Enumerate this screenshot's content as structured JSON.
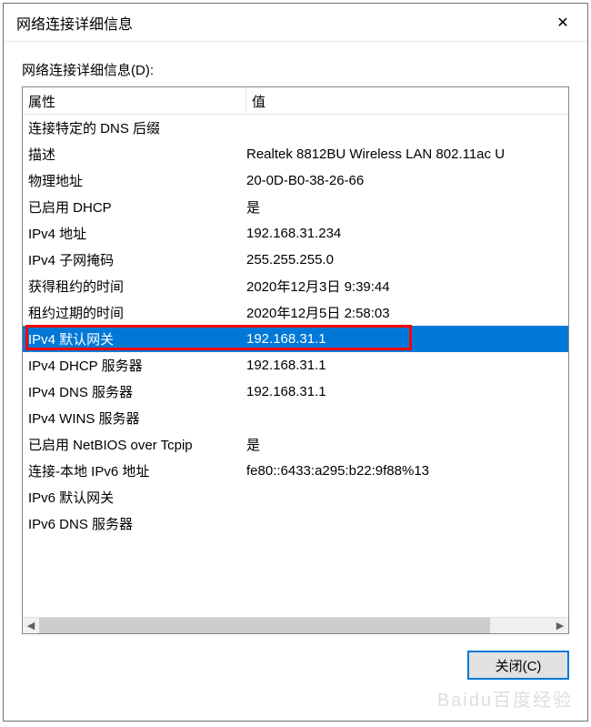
{
  "window": {
    "title": "网络连接详细信息",
    "close_icon": "✕"
  },
  "subtitle": "网络连接详细信息(D):",
  "headers": {
    "property": "属性",
    "value": "值"
  },
  "rows": [
    {
      "property": "连接特定的 DNS 后缀",
      "value": ""
    },
    {
      "property": "描述",
      "value": "Realtek 8812BU Wireless LAN 802.11ac U"
    },
    {
      "property": "物理地址",
      "value": "20-0D-B0-38-26-66"
    },
    {
      "property": "已启用 DHCP",
      "value": "是"
    },
    {
      "property": "IPv4 地址",
      "value": "192.168.31.234"
    },
    {
      "property": "IPv4 子网掩码",
      "value": "255.255.255.0"
    },
    {
      "property": "获得租约的时间",
      "value": "2020年12月3日 9:39:44"
    },
    {
      "property": "租约过期的时间",
      "value": "2020年12月5日 2:58:03"
    },
    {
      "property": "IPv4 默认网关",
      "value": "192.168.31.1",
      "selected": true
    },
    {
      "property": "IPv4 DHCP 服务器",
      "value": "192.168.31.1"
    },
    {
      "property": "IPv4 DNS 服务器",
      "value": "192.168.31.1"
    },
    {
      "property": "IPv4 WINS 服务器",
      "value": ""
    },
    {
      "property": "已启用 NetBIOS over Tcpip",
      "value": "是"
    },
    {
      "property": "连接-本地 IPv6 地址",
      "value": "fe80::6433:a295:b22:9f88%13"
    },
    {
      "property": "IPv6 默认网关",
      "value": ""
    },
    {
      "property": "IPv6 DNS 服务器",
      "value": ""
    }
  ],
  "scroll": {
    "left_arrow": "◀",
    "right_arrow": "▶"
  },
  "buttons": {
    "close": "关闭(C)"
  },
  "watermark": "Baidu百度经验"
}
